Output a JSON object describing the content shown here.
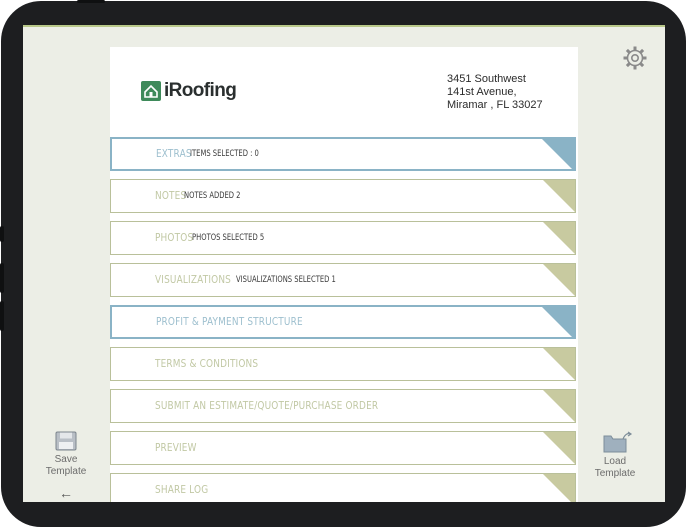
{
  "company": {
    "logo_text": "iRoofing",
    "address_line1": "3451 Southwest",
    "address_line2": "141st Avenue,",
    "address_line3": "Miramar , FL 33027"
  },
  "sections": [
    {
      "title": "Extras",
      "detail": "Items Selected : 0",
      "active": true
    },
    {
      "title": "Notes",
      "detail": "Notes Added 2",
      "active": false
    },
    {
      "title": "Photos",
      "detail": "Photos Selected 5",
      "active": false
    },
    {
      "title": "Visualizations",
      "detail": "Visualizations Selected 1",
      "active": false
    },
    {
      "title": "Profit & Payment Structure",
      "detail": "",
      "active": true
    },
    {
      "title": "Terms & Conditions",
      "detail": "",
      "active": false
    },
    {
      "title": "Submit an Estimate/Quote/Purchase Order",
      "detail": "",
      "active": false
    },
    {
      "title": "Preview",
      "detail": "",
      "active": false
    },
    {
      "title": "Share Log",
      "detail": "",
      "active": false
    }
  ],
  "toolbar": {
    "save_label_line1": "Save",
    "save_label_line2": "Template",
    "load_label_line1": "Load",
    "load_label_line2": "Template",
    "back_glyph": "←"
  },
  "icons": {
    "settings": "gear-icon",
    "save": "floppy-disk-icon",
    "load": "folder-upload-icon",
    "back": "back-arrow-icon"
  },
  "colors": {
    "accent_olive": "#c8caa0",
    "accent_blue": "#8ab3c6",
    "screen_bg": "#eceee6",
    "brand_green": "#3e8a5a"
  }
}
